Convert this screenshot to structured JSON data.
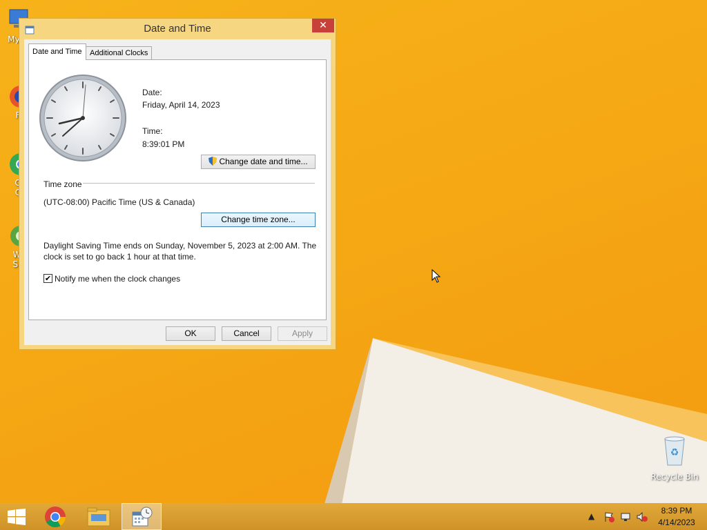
{
  "desktop": {
    "icons": [
      {
        "label": "My C"
      },
      {
        "label": "F"
      },
      {
        "label": "G\nC"
      },
      {
        "label": "Wi\nSh"
      }
    ],
    "recycle_bin": {
      "label": "Recycle Bin"
    }
  },
  "window": {
    "title": "Date and Time",
    "close_glyph": "✕",
    "tabs": [
      {
        "label": "Date and Time",
        "selected": true
      },
      {
        "label": "Additional Clocks",
        "selected": false
      }
    ],
    "date_label": "Date:",
    "date_value": "Friday, April 14, 2023",
    "time_label": "Time:",
    "time_value": "8:39:01 PM",
    "change_datetime_button": "Change date and time...",
    "timezone_heading": "Time zone",
    "timezone_value": "(UTC-08:00) Pacific Time (US & Canada)",
    "change_timezone_button": "Change time zone...",
    "dst_line1": "Daylight Saving Time ends on Sunday, November 5, 2023 at 2:00 AM. The",
    "dst_line2": "clock is set to go back 1 hour at that time.",
    "notify_label": "Notify me when the clock changes",
    "notify_checked": true,
    "ok_button": "OK",
    "cancel_button": "Cancel",
    "apply_button": "Apply"
  },
  "taskbar": {
    "clock_time": "8:39 PM",
    "clock_date": "4/14/2023"
  },
  "colors": {
    "desktop_bg": "#f5a814",
    "window_frame": "#f7d682",
    "close_button": "#c7403a",
    "taskbar": "#d89b2b"
  }
}
